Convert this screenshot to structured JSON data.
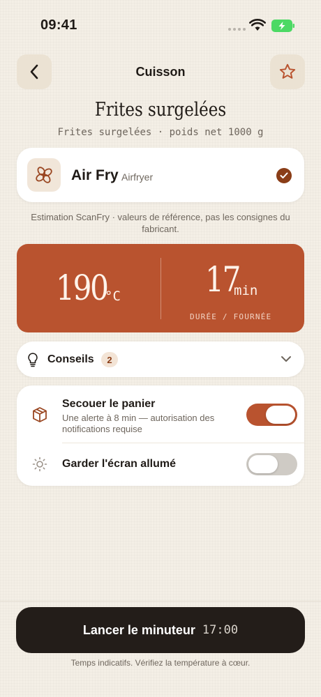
{
  "status_bar": {
    "time": "09:41"
  },
  "header": {
    "title": "Cuisson",
    "back_icon": "chevron-left-icon",
    "favorite_icon": "star-icon"
  },
  "product": {
    "title": "Frites surgelées",
    "subtitle": "Frites surgelées · poids net 1000 g"
  },
  "mode": {
    "name": "Air Fry",
    "sublabel": "Airfryer",
    "icon": "fan-icon",
    "selected": true
  },
  "estimate_note": "Estimation ScanFry · valeurs de référence, pas les consignes du fabricant.",
  "params": {
    "temperature": "190",
    "temperature_unit": "°C",
    "duration": "17",
    "duration_unit": "min",
    "duration_label": "DURÉE / FOURNÉE",
    "accent_color": "#b9532f"
  },
  "tips": {
    "label": "Conseils",
    "count": "2"
  },
  "options": [
    {
      "title": "Secouer le panier",
      "description": "Une alerte à 8 min — autorisation des notifications requise",
      "icon": "box-icon",
      "enabled": true
    },
    {
      "title": "Garder l'écran allumé",
      "icon": "sun-icon",
      "enabled": false
    }
  ],
  "footer": {
    "start_label": "Lancer le minuteur",
    "start_time": "17:00",
    "note": "Temps indicatifs. Vérifiez la température à cœur."
  }
}
